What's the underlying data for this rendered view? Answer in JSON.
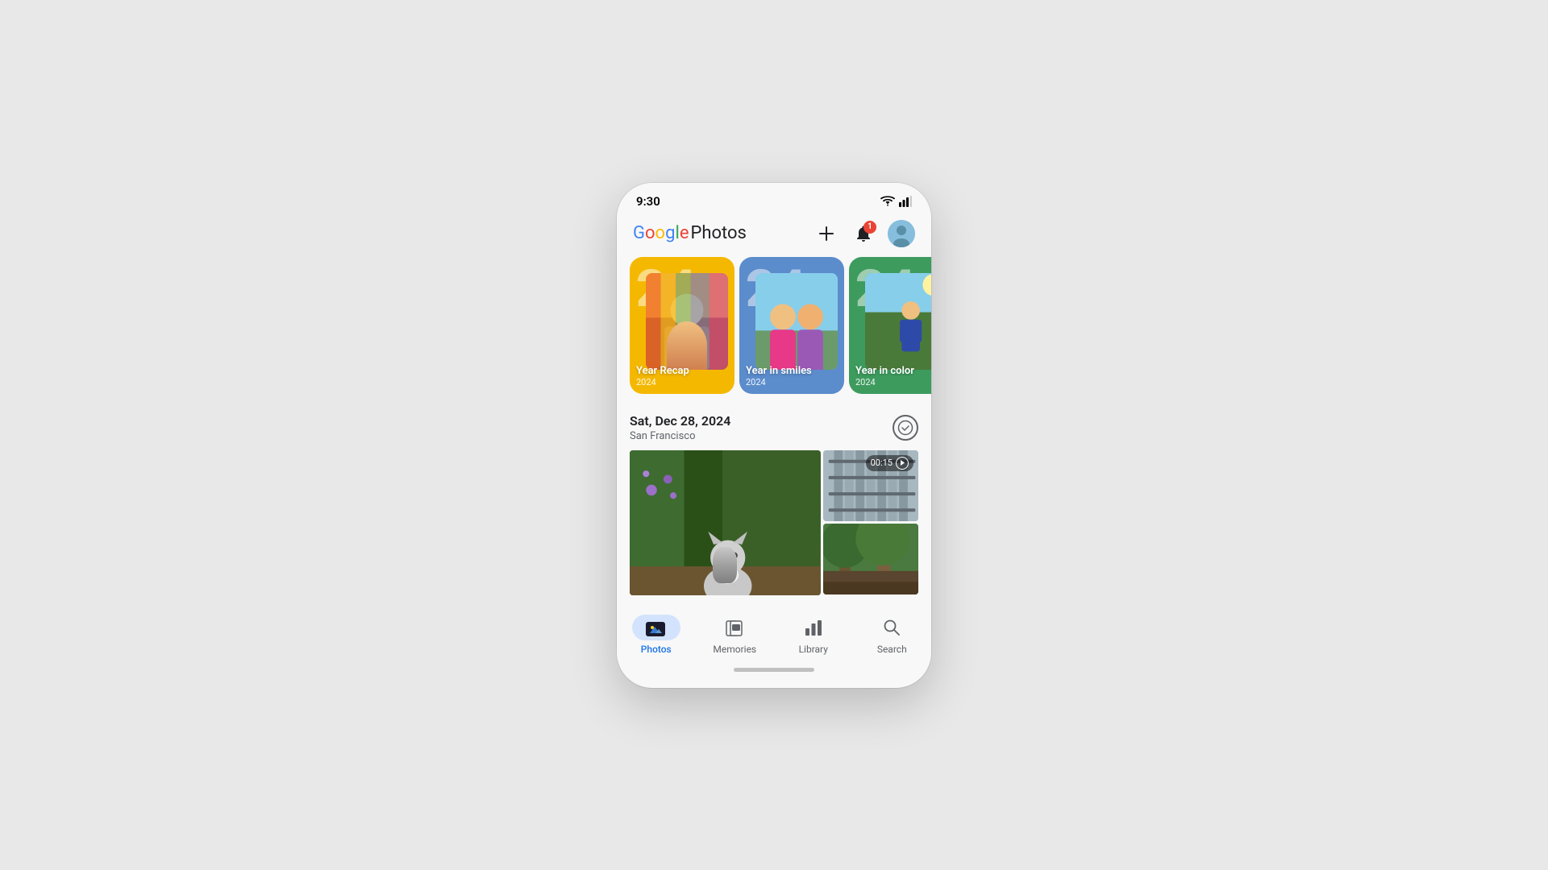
{
  "statusBar": {
    "time": "9:30"
  },
  "header": {
    "logoGoogle": "Google",
    "logoPhotos": "Photos",
    "addLabel": "+",
    "notifBadge": "1",
    "avatarAlt": "User avatar"
  },
  "memoriesStrip": {
    "cards": [
      {
        "id": "year-recap",
        "year": "24",
        "title": "Year Recap",
        "yearLabel": "2024",
        "bgColor": "#F5B800",
        "photoType": "selfie"
      },
      {
        "id": "year-smiles",
        "year": "24",
        "title": "Year in smiles",
        "yearLabel": "2024",
        "bgColor": "#5B8CCC",
        "photoType": "group"
      },
      {
        "id": "year-color",
        "year": "24",
        "title": "Year in color",
        "yearLabel": "2024",
        "bgColor": "#3D9B5E",
        "photoType": "outdoor"
      }
    ]
  },
  "dateSection": {
    "date": "Sat, Dec 28, 2024",
    "location": "San Francisco"
  },
  "photos": [
    {
      "id": "cat-photo",
      "type": "cat",
      "isVideo": false
    },
    {
      "id": "stairs-video",
      "type": "stairs",
      "isVideo": true,
      "duration": "00:15"
    },
    {
      "id": "trees-photo",
      "type": "trees",
      "isVideo": false
    }
  ],
  "bottomNav": {
    "items": [
      {
        "id": "photos",
        "label": "Photos",
        "active": true
      },
      {
        "id": "memories",
        "label": "Memories",
        "active": false
      },
      {
        "id": "library",
        "label": "Library",
        "active": false
      },
      {
        "id": "search",
        "label": "Search",
        "active": false
      }
    ]
  }
}
